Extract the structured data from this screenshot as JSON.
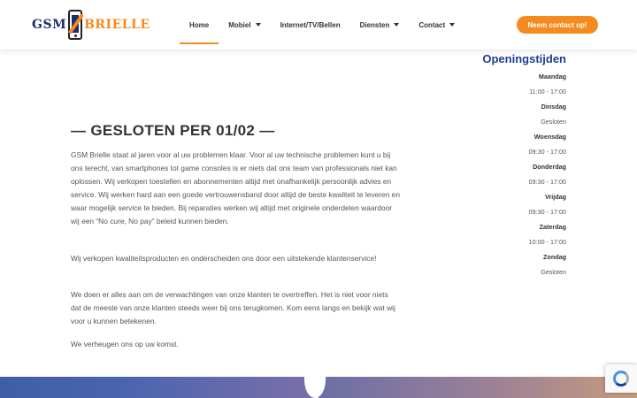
{
  "header": {
    "logo": {
      "left": "GSM",
      "right": "BRIELLE"
    },
    "nav": [
      {
        "label": "Home",
        "dropdown": false,
        "active": true
      },
      {
        "label": "Mobiel",
        "dropdown": true,
        "active": false
      },
      {
        "label": "Internet/TV/Bellen",
        "dropdown": false,
        "active": false
      },
      {
        "label": "Diensten",
        "dropdown": true,
        "active": false
      },
      {
        "label": "Contact",
        "dropdown": true,
        "active": false
      }
    ],
    "cta_label": "Neem contact op!"
  },
  "main": {
    "headline": "— GESLOTEN PER 01/02 —",
    "paragraphs": [
      "GSM Brielle staat al jaren voor al uw problemen klaar. Voor al uw technische problemen kunt u bij ons terecht, van smartphones tot game consoles is er niets dat ons team van professionals niet kan oplossen. Wij verkopen toestellen en abonnementen altijd met onafhankelijk persoonlijk advies en service. Wij werken hard aan een goede vertrouwensband door altijd de beste kwaliteit te leveren en waar mogelijk service te bieden. Bij reparaties werken wij altijd met originele onderdelen waardoor wij een “No cure, No pay” beleid kunnen bieden.",
      "Wij verkopen kwaliteitsproducten en onderscheiden ons door een uitstekende klantenservice!",
      "We doen er alles aan om de verwachtingen van onze klanten te overtreffen. Het is niet voor niets dat de meeste van onze klanten steeds weer bij ons terugkomen. Kom eens langs en bekijk wat wij voor u kunnen betekenen.",
      "We verheugen ons op uw komst."
    ]
  },
  "hours": {
    "title": "Openingstijden",
    "days": [
      {
        "day": "Maandag",
        "time": "11:00 - 17:00"
      },
      {
        "day": "Dinsdag",
        "time": "Gesloten"
      },
      {
        "day": "Woensdag",
        "time": "09:30 - 17:00"
      },
      {
        "day": "Donderdag",
        "time": "09:30 - 17:00"
      },
      {
        "day": "Vrijdag",
        "time": "09:30 - 17:00"
      },
      {
        "day": "Zaterdag",
        "time": "10:00 - 17:00"
      },
      {
        "day": "Zondag",
        "time": "Gesloten"
      }
    ]
  },
  "colors": {
    "accent": "#f58a1f",
    "brand_blue": "#1d3f8f"
  },
  "icons": [
    "phone-logo-icon",
    "chevron-down-icon",
    "recaptcha-icon"
  ]
}
